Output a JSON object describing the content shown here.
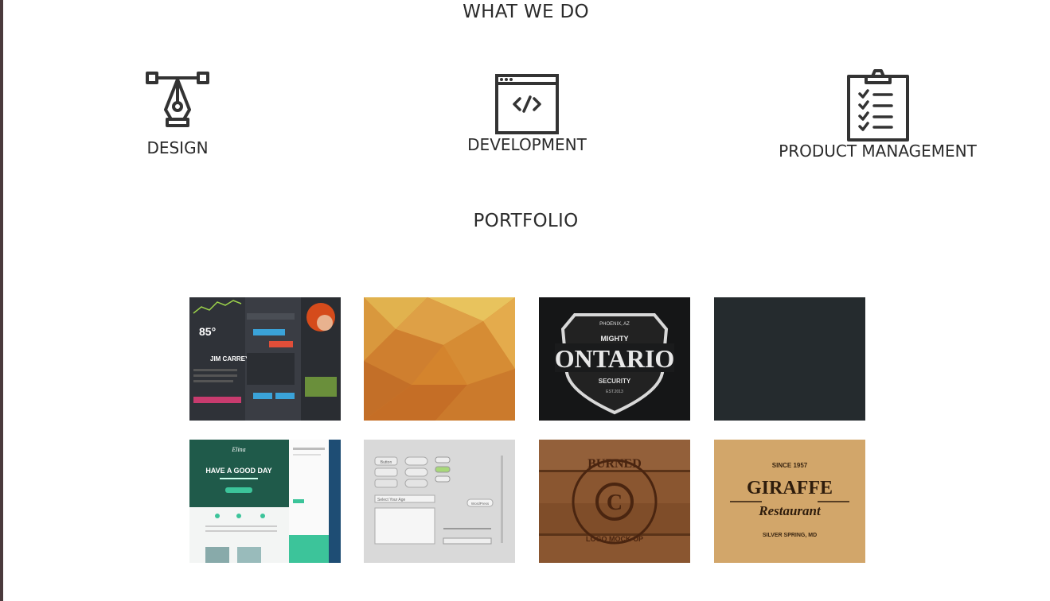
{
  "sections": {
    "services_title": "WHAT WE DO",
    "portfolio_title": "PORTFOLIO"
  },
  "services": [
    {
      "label": "DESIGN",
      "icon": "pen-tool-icon"
    },
    {
      "label": "DEVELOPMENT",
      "icon": "code-window-icon"
    },
    {
      "label": "PRODUCT MANAGEMENT",
      "icon": "clipboard-checklist-icon"
    }
  ],
  "portfolio": {
    "tiles": [
      {
        "name": "dark-ui-kit",
        "badge": "85°",
        "title": "JIM CARREY"
      },
      {
        "name": "orange-polygon"
      },
      {
        "name": "ontario-security-badge",
        "top": "PHOENIX, AZ",
        "pre": "MIGHTY",
        "main": "ONTARIO",
        "sub": "SECURITY",
        "est": "EST.2013"
      },
      {
        "name": "dark-slate"
      },
      {
        "name": "green-email-template",
        "brand": "Elina",
        "headline": "HAVE A GOOD DAY"
      },
      {
        "name": "light-ui-elements",
        "button": "Button",
        "select": "Select Your Age",
        "wp": "WordPress"
      },
      {
        "name": "burned-wood-logo",
        "arc_top": "BURNED",
        "letter": "C",
        "arc_bottom": "LOGO MOCK-UP"
      },
      {
        "name": "giraffe-restaurant",
        "since": "SINCE 1957",
        "main": "GIRAFFE",
        "script": "Restaurant",
        "place": "SILVER SPRING, MD"
      }
    ]
  },
  "colors": {
    "text": "#2b2b2b",
    "dark_tile": "#252b2e",
    "orange": "#d98a2b",
    "wood": "#8a5630",
    "kraft": "#d2a66a"
  }
}
